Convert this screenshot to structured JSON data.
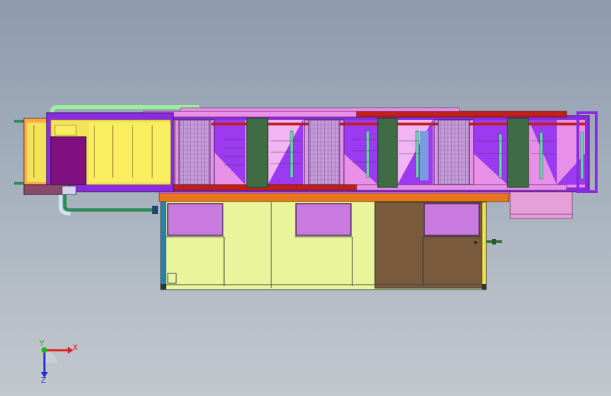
{
  "viewport": {
    "background_top": "#8d9bad",
    "background_bottom": "#c3c8ce"
  },
  "triad": {
    "x_label": "X",
    "y_label": "Y",
    "z_label": "Z",
    "x_color": "#e02020",
    "y_color": "#20b020",
    "z_color": "#2030d0"
  },
  "model": {
    "cabinet_color": "#e8f59a",
    "cabinet_dark_color": "#7a5a3c",
    "window_color": "#c97adf",
    "frame_color": "#8a2be2",
    "panel_color": "#e890e8",
    "column_color": "#3f6b45",
    "rail_color": "#c0201a",
    "pipe_color": "#2e8b57",
    "inlet_color": "#f2e35a",
    "beam_color": "#e8761a",
    "tray_color": "#e6a0d8"
  }
}
